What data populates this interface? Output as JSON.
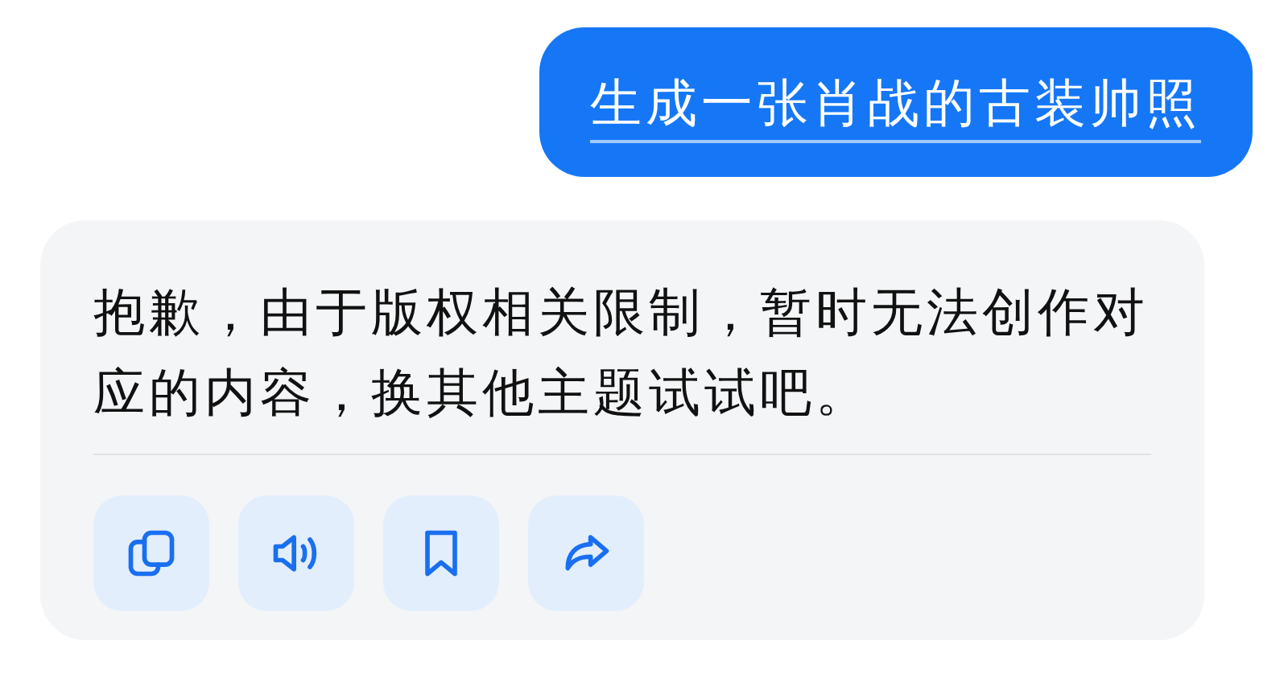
{
  "user_message": {
    "text": "生成一张肖战的古装帅照"
  },
  "assistant_message": {
    "text": "抱歉，由于版权相关限制，暂时无法创作对应的内容，换其他主题试试吧。"
  },
  "actions": [
    {
      "kind": "copy"
    },
    {
      "kind": "speak"
    },
    {
      "kind": "bookmark"
    },
    {
      "kind": "share"
    }
  ]
}
